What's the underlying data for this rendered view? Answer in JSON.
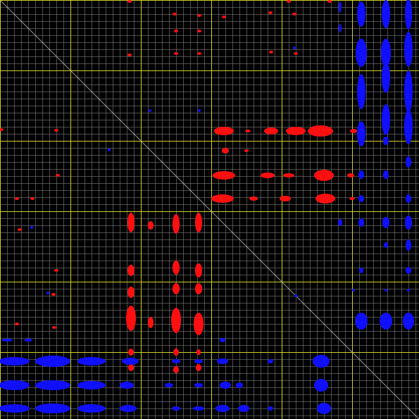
{
  "colors": {
    "background": "#000000",
    "minor_grid": "#8a8a8a",
    "major_grid": "#e6e61e",
    "diagonal": "#bfbfbf",
    "red": "#ff1010",
    "blue": "#1010ff"
  }
}
